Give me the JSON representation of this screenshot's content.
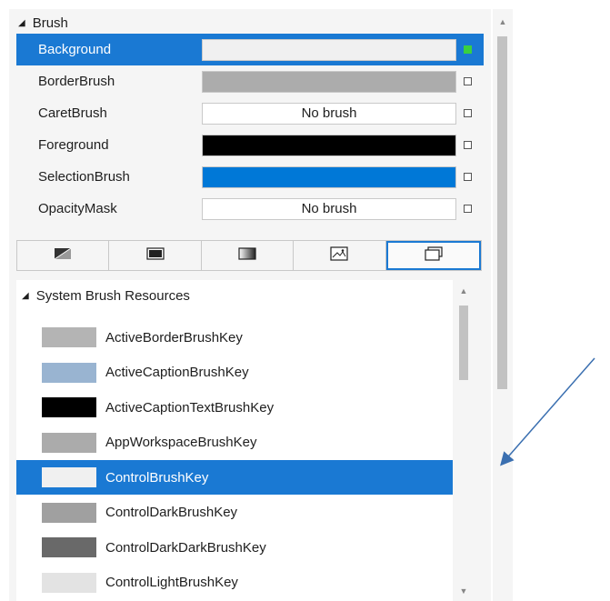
{
  "brush_section": {
    "title": "Brush",
    "properties": [
      {
        "name": "Background",
        "value": "",
        "fill": "#f0f0f0",
        "selected": true
      },
      {
        "name": "BorderBrush",
        "value": "",
        "fill": "#acacac",
        "selected": false
      },
      {
        "name": "CaretBrush",
        "value": "No brush",
        "fill": "#ffffff",
        "selected": false
      },
      {
        "name": "Foreground",
        "value": "",
        "fill": "#000000",
        "selected": false
      },
      {
        "name": "SelectionBrush",
        "value": "",
        "fill": "#0078d7",
        "selected": false
      },
      {
        "name": "OpacityMask",
        "value": "No brush",
        "fill": "#ffffff",
        "selected": false
      }
    ]
  },
  "brush_tabs": [
    {
      "icon": "null-brush-icon",
      "active": false
    },
    {
      "icon": "solid-color-brush-icon",
      "active": false
    },
    {
      "icon": "gradient-brush-icon",
      "active": false
    },
    {
      "icon": "image-brush-icon",
      "active": false
    },
    {
      "icon": "brush-resources-icon",
      "active": true
    }
  ],
  "resources": {
    "title": "System Brush Resources",
    "items": [
      {
        "label": "ActiveBorderBrushKey",
        "color": "#b4b4b4",
        "selected": false
      },
      {
        "label": "ActiveCaptionBrushKey",
        "color": "#99b4d1",
        "selected": false
      },
      {
        "label": "ActiveCaptionTextBrushKey",
        "color": "#000000",
        "selected": false
      },
      {
        "label": "AppWorkspaceBrushKey",
        "color": "#ababab",
        "selected": false
      },
      {
        "label": "ControlBrushKey",
        "color": "#f0f0f0",
        "selected": true
      },
      {
        "label": "ControlDarkBrushKey",
        "color": "#a0a0a0",
        "selected": false
      },
      {
        "label": "ControlDarkDarkBrushKey",
        "color": "#696969",
        "selected": false
      },
      {
        "label": "ControlLightBrushKey",
        "color": "#e3e3e3",
        "selected": false
      }
    ]
  },
  "colors": {
    "accent": "#1a79d3",
    "annotation_arrow": "#3a6fb0"
  }
}
